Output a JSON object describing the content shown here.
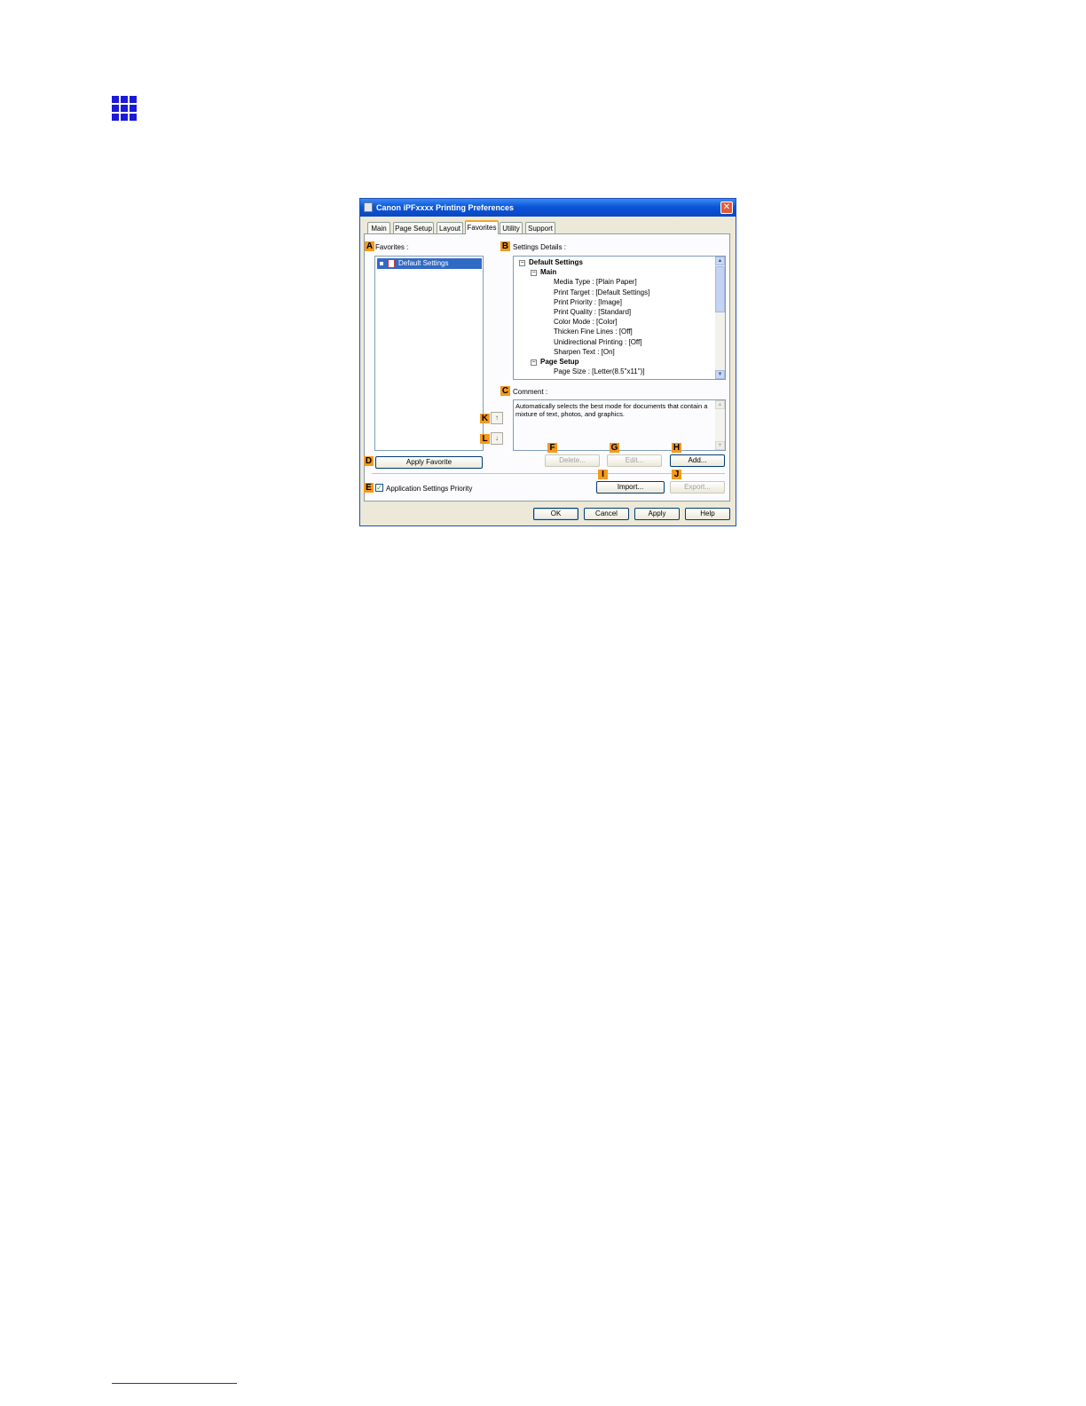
{
  "dialog": {
    "title": "Canon iPFxxxx Printing Preferences",
    "close": "✕",
    "tabs": [
      "Main",
      "Page Setup",
      "Layout",
      "Favorites",
      "Utility",
      "Support"
    ],
    "active_tab": "Favorites"
  },
  "markers": {
    "A": "A",
    "B": "B",
    "C": "C",
    "D": "D",
    "E": "E",
    "F": "F",
    "G": "G",
    "H": "H",
    "I": "I",
    "J": "J",
    "K": "K",
    "L": "L"
  },
  "favorites": {
    "label": "Favorites :",
    "items": [
      "Default Settings"
    ]
  },
  "settings_details": {
    "label": "Settings Details :",
    "tree": [
      {
        "text": "Default Settings",
        "level": 0,
        "bold": true,
        "expander": "−"
      },
      {
        "text": "Main",
        "level": 1,
        "bold": true,
        "expander": "−"
      },
      {
        "text": "Media Type : [Plain Paper]",
        "level": 2
      },
      {
        "text": "Print Target : [Default Settings]",
        "level": 2
      },
      {
        "text": "Print Priority : [Image]",
        "level": 2
      },
      {
        "text": "Print Quality : [Standard]",
        "level": 2
      },
      {
        "text": "Color Mode : [Color]",
        "level": 2
      },
      {
        "text": "Thicken Fine Lines : [Off]",
        "level": 2
      },
      {
        "text": "Unidirectional Printing : [Off]",
        "level": 2
      },
      {
        "text": "Sharpen Text : [On]",
        "level": 2
      },
      {
        "text": "Page Setup",
        "level": 1,
        "bold": true,
        "expander": "−"
      },
      {
        "text": "Page Size : [Letter(8.5\"x11\")]",
        "level": 2
      }
    ]
  },
  "comment": {
    "label": "Comment :",
    "text": "Automatically selects the best mode for documents that contain a mixture of text, photos, and graphics."
  },
  "buttons": {
    "apply_favorite": "Apply Favorite",
    "delete": "Delete...",
    "edit": "Edit...",
    "add": "Add...",
    "import": "Import...",
    "export": "Export...",
    "ok": "OK",
    "cancel": "Cancel",
    "apply": "Apply",
    "help": "Help",
    "move_up": "↑",
    "move_down": "↓"
  },
  "app_priority": {
    "label": "Application Settings Priority",
    "checked": true
  },
  "scroll": {
    "up": "▲",
    "down": "▼"
  }
}
